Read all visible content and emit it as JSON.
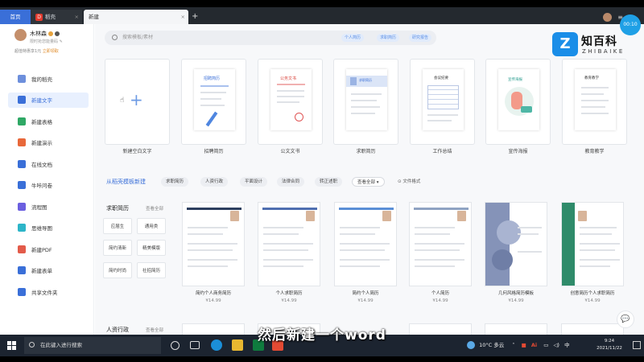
{
  "tabs": {
    "home": "首页",
    "docer": "稻壳",
    "new_tab": "新建",
    "close": "×",
    "add": "+"
  },
  "timer": "00:10",
  "brand": {
    "cn": "知百科",
    "en": "ZHIBAIKE",
    "mark": "Z"
  },
  "user": {
    "name": "木林森",
    "subtitle": "限时抢您能量码 ✎",
    "promo": "超值特惠享1元",
    "promo_link": "立即领取"
  },
  "nav": [
    {
      "label": "我的稻壳",
      "color": "#6d8fdc"
    },
    {
      "label": "新建文字",
      "color": "#3a6fd8"
    },
    {
      "label": "新建表格",
      "color": "#2fa865"
    },
    {
      "label": "新建演示",
      "color": "#e8683a"
    },
    {
      "label": "在线文档",
      "color": "#3a6fd8"
    },
    {
      "label": "牛咔问卷",
      "color": "#3a6fd8"
    },
    {
      "label": "流程图",
      "color": "#6b5fe0"
    },
    {
      "label": "思维导图",
      "color": "#2db5c8"
    },
    {
      "label": "新建PDF",
      "color": "#e35b4a"
    },
    {
      "label": "新建表单",
      "color": "#3a6fd8"
    },
    {
      "label": "共享文件夹",
      "color": "#3a6fd8"
    }
  ],
  "search": {
    "placeholder": "搜索模板/素材",
    "chips": [
      "个人简历",
      "求职简历",
      "研究报告"
    ]
  },
  "new_cards": [
    "新建空白文字",
    "招聘简历",
    "公文文书",
    "求职简历",
    "工作总结",
    "宣传海报",
    "教育教学"
  ],
  "new_card_titles": {
    "c1": "招聘简历",
    "c2": "公务文书",
    "c3": "求职简历",
    "c4": "会议纪要",
    "c5": "宣传海报",
    "c6": "教育教学"
  },
  "section": {
    "title": "从稻壳模板新建",
    "filters": [
      "求职简历",
      "人资行政",
      "平面设计",
      "法律合同",
      "转正述职",
      "查看全部"
    ],
    "link": "⊙ 文件格式"
  },
  "category": {
    "title": "求职简历",
    "more": "查看全部",
    "buttons": [
      "应届生",
      "通用类",
      "简约清新",
      "精美模版",
      "简约时尚",
      "社招简历"
    ]
  },
  "resumes": [
    {
      "label": "简约个人商务简历",
      "price": "¥14.99"
    },
    {
      "label": "个人求职简历",
      "price": "¥14.99"
    },
    {
      "label": "简约个人简历",
      "price": "¥14.99"
    },
    {
      "label": "个人简历",
      "price": "¥14.99"
    },
    {
      "label": "几何风格简历模板",
      "price": "¥14.99"
    },
    {
      "label": "创意简历个人求职简历",
      "price": "¥14.99"
    }
  ],
  "category2": {
    "title": "人资行政",
    "more": "查看全部"
  },
  "subtitle": "然后新建一个word",
  "taskbar": {
    "search_placeholder": "在此键入进行搜索",
    "weather": "10°C 多云",
    "time": "9:24",
    "date": "2021/11/22",
    "ime": "中",
    "ai": "Ai"
  }
}
